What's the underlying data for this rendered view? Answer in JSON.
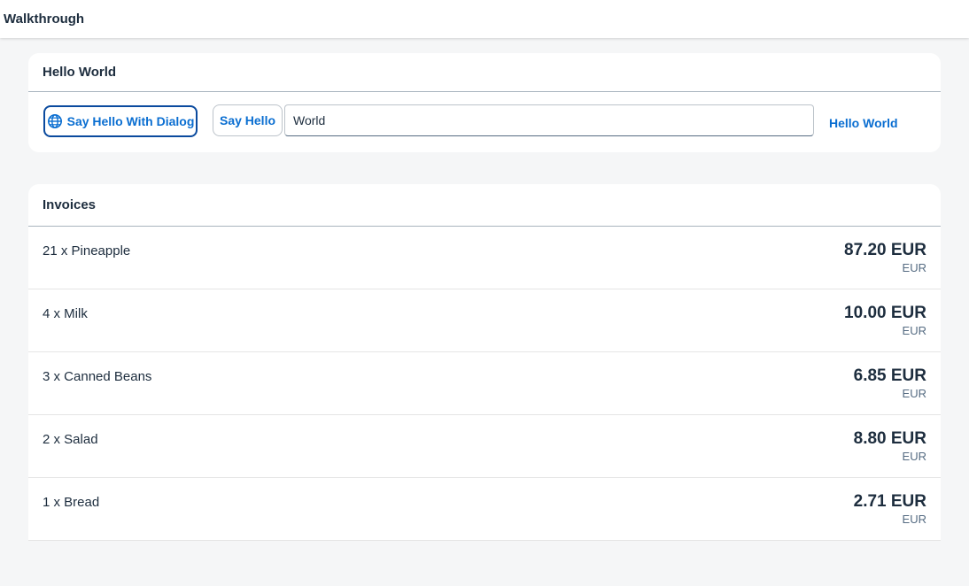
{
  "app": {
    "title": "Walkthrough"
  },
  "hello_panel": {
    "title": "Hello World",
    "dialog_button_label": "Say Hello With Dialog",
    "dialog_button_icon": "globe-icon",
    "hello_button_label": "Say Hello",
    "input_value": "World",
    "greeting_text": "Hello World"
  },
  "invoices": {
    "title": "Invoices",
    "items": [
      {
        "title": "21 x Pineapple",
        "amount": "87.20 EUR",
        "unit": "EUR"
      },
      {
        "title": "4 x Milk",
        "amount": "10.00 EUR",
        "unit": "EUR"
      },
      {
        "title": "3 x Canned Beans",
        "amount": "6.85 EUR",
        "unit": "EUR"
      },
      {
        "title": "2 x Salad",
        "amount": "8.80 EUR",
        "unit": "EUR"
      },
      {
        "title": "1 x Bread",
        "amount": "2.71 EUR",
        "unit": "EUR"
      }
    ]
  },
  "colors": {
    "accent": "#0a6ed1",
    "focus_border": "#0a4a9e",
    "background": "#f5f6f7",
    "text": "#1d2d3e"
  }
}
